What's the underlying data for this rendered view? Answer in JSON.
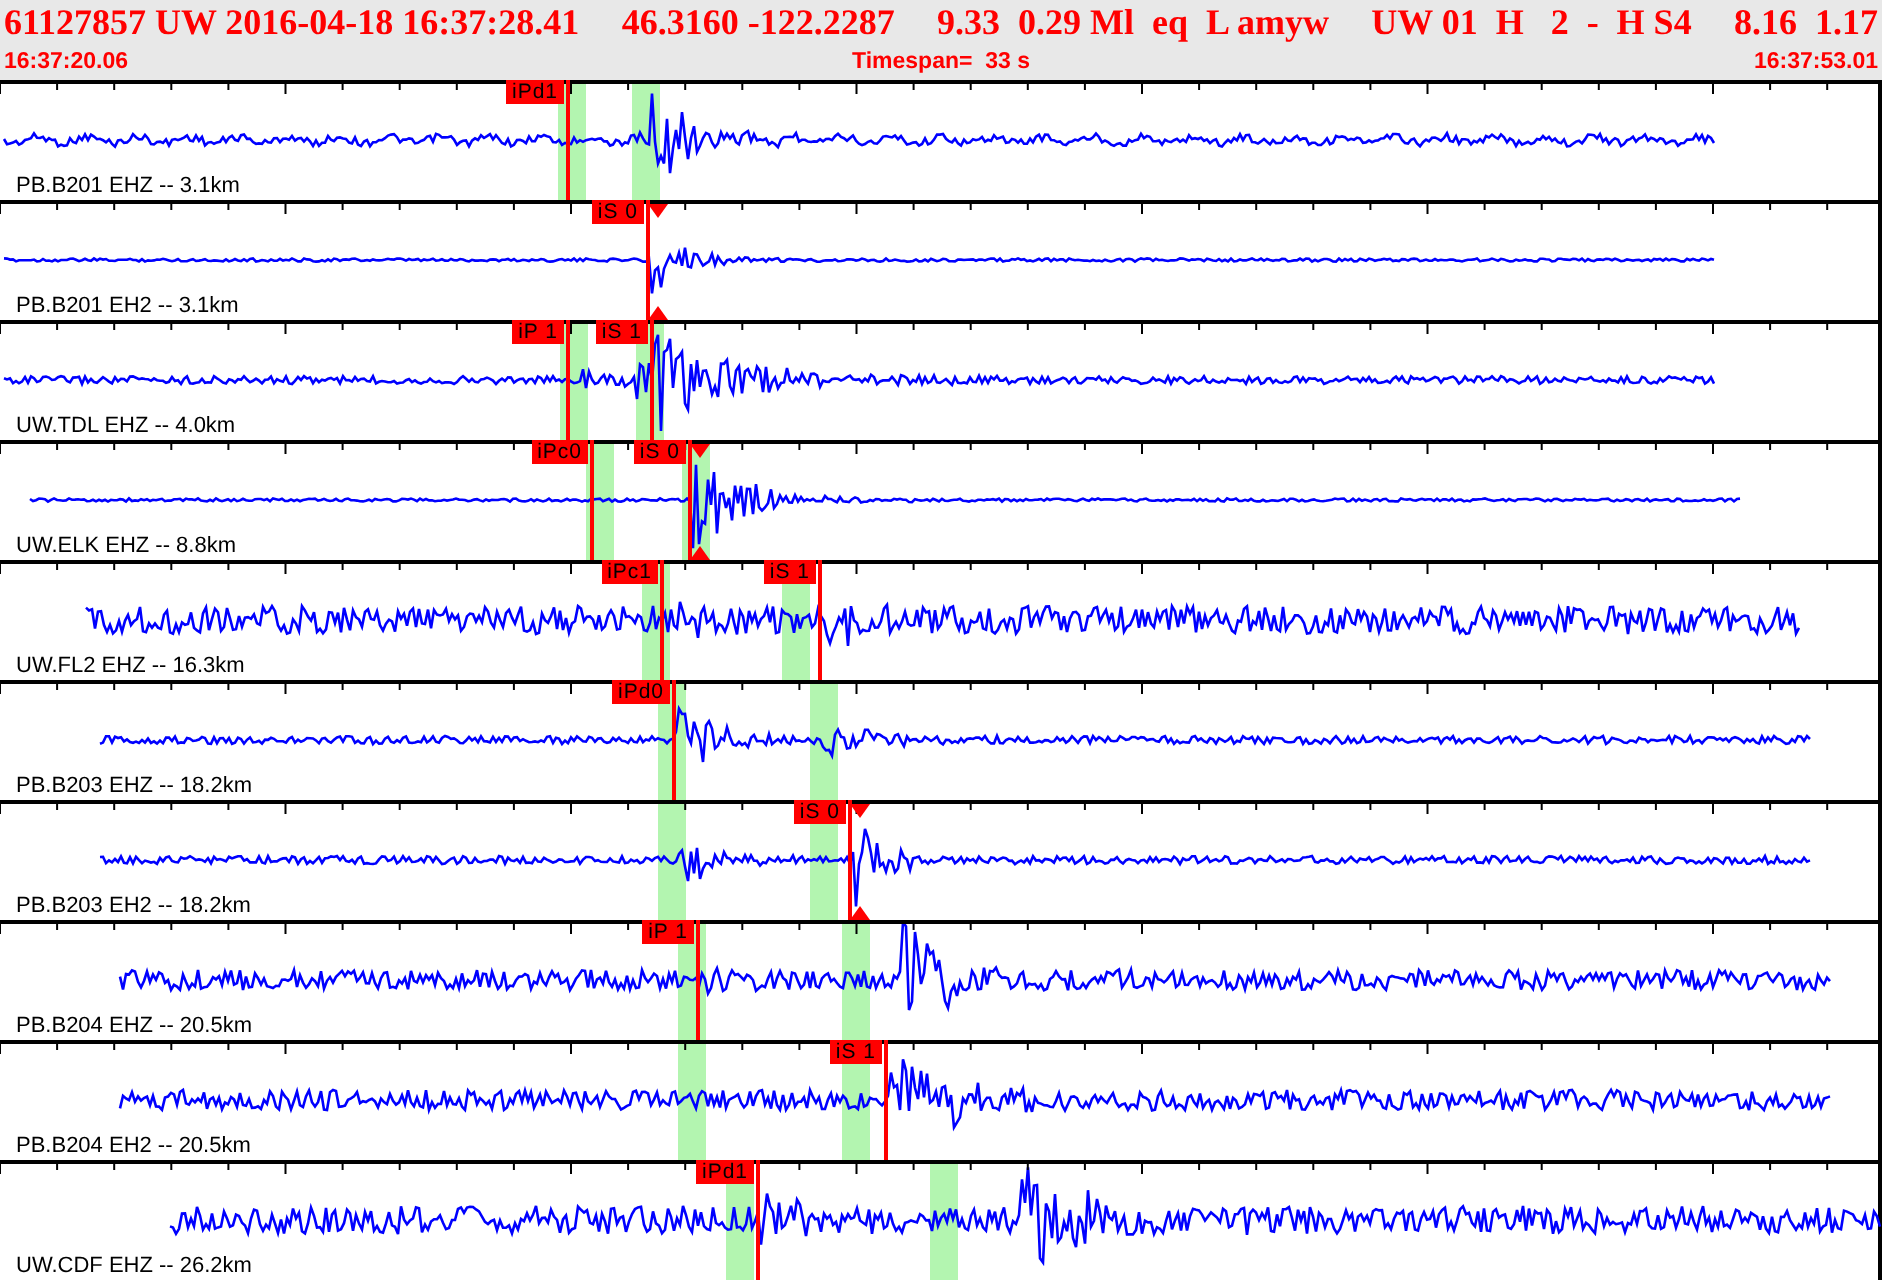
{
  "header": {
    "summary": [
      "61127857 UW 2016-04-18 16:37:28.41",
      "46.3160 -122.2287",
      "9.33  0.29 Ml  eq  L amyw",
      "UW 01  H   2  -  H S4",
      "8.16  1.17"
    ],
    "start_time": "16:37:20.06",
    "timespan": "Timespan=  33 s",
    "end_time": "16:37:53.01"
  },
  "traces": [
    {
      "label": "PB.B201 EHZ -- 3.1km",
      "picks": [
        {
          "label": "iPd1",
          "flagged": false
        }
      ]
    },
    {
      "label": "PB.B201 EH2 -- 3.1km",
      "picks": [
        {
          "label": "iS 0",
          "flagged": true
        }
      ]
    },
    {
      "label": "UW.TDL EHZ -- 4.0km",
      "picks": [
        {
          "label": "iP 1",
          "flagged": false
        },
        {
          "label": "iS 1",
          "flagged": false
        }
      ]
    },
    {
      "label": "UW.ELK EHZ -- 8.8km",
      "picks": [
        {
          "label": "iPc0",
          "flagged": false
        },
        {
          "label": "iS 0",
          "flagged": true
        }
      ]
    },
    {
      "label": "UW.FL2 EHZ -- 16.3km",
      "picks": [
        {
          "label": "iPc1",
          "flagged": false
        },
        {
          "label": "iS 1",
          "flagged": false
        }
      ]
    },
    {
      "label": "PB.B203 EHZ -- 18.2km",
      "picks": [
        {
          "label": "iPd0",
          "flagged": false
        }
      ]
    },
    {
      "label": "PB.B203 EH2 -- 18.2km",
      "picks": [
        {
          "label": "iS 0",
          "flagged": true
        }
      ]
    },
    {
      "label": "PB.B204 EHZ -- 20.5km",
      "picks": [
        {
          "label": "iP 1",
          "flagged": false
        }
      ]
    },
    {
      "label": "PB.B204 EH2 -- 20.5km",
      "picks": [
        {
          "label": "iS 1",
          "flagged": false
        }
      ]
    },
    {
      "label": "UW.CDF EHZ -- 26.2km",
      "picks": [
        {
          "label": "iPd1",
          "flagged": false
        }
      ]
    }
  ]
}
